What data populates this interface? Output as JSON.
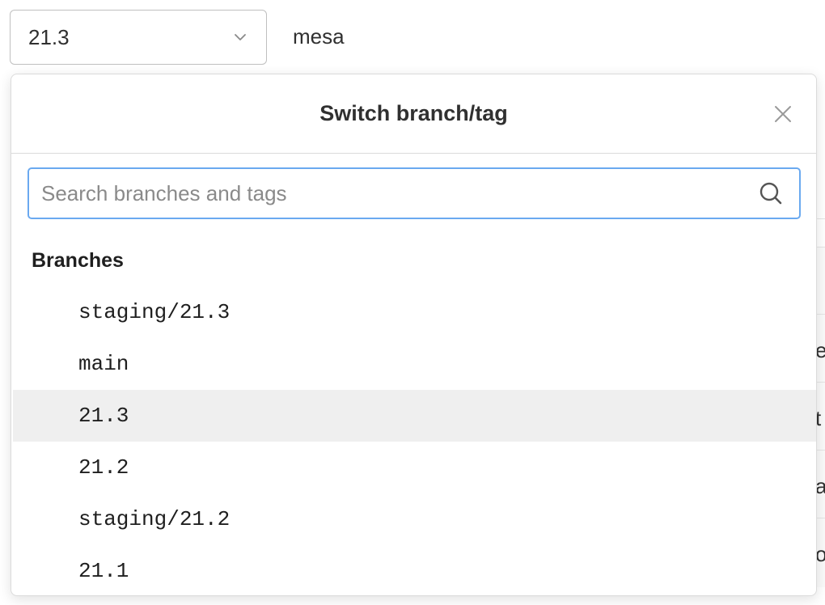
{
  "ref_selector": {
    "selected": "21.3"
  },
  "project": {
    "name": "mesa"
  },
  "dropdown": {
    "title": "Switch branch/tag",
    "search": {
      "placeholder": "Search branches and tags",
      "value": ""
    },
    "section_label": "Branches",
    "branches": [
      {
        "label": "staging/21.3",
        "active": false
      },
      {
        "label": "main",
        "active": false
      },
      {
        "label": "21.3",
        "active": true
      },
      {
        "label": "21.2",
        "active": false
      },
      {
        "label": "staging/21.2",
        "active": false
      },
      {
        "label": "21.1",
        "active": false
      }
    ]
  },
  "background_fragments": [
    "e",
    "t",
    "a",
    "o"
  ],
  "icons": {
    "chevron": "chevron-down-icon",
    "close": "close-icon",
    "search": "search-icon"
  },
  "colors": {
    "focus_border": "#6aa9f0",
    "active_row": "#efefef"
  }
}
